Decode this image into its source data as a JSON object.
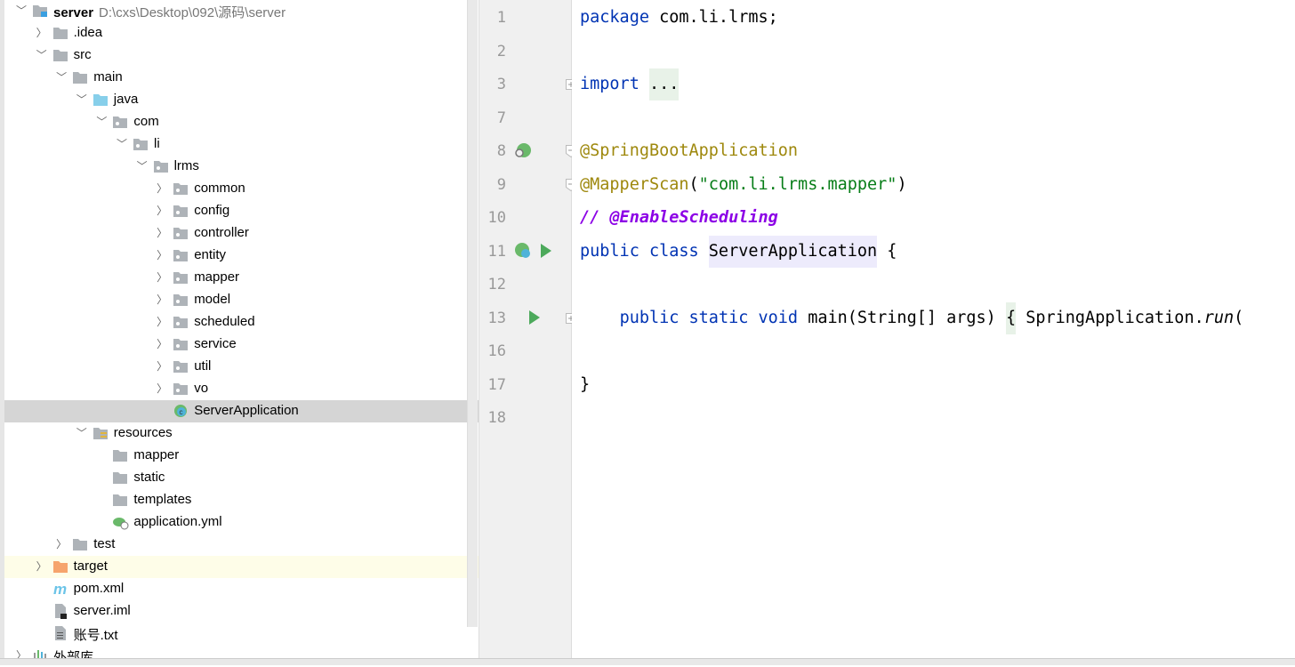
{
  "tree": [
    {
      "label": "server",
      "path": "D:\\cxs\\Desktop\\092\\源码\\server",
      "level": 0,
      "chevron": "down",
      "icon": "module",
      "bold": true
    },
    {
      "label": ".idea",
      "level": 1,
      "chevron": "right",
      "icon": "folder"
    },
    {
      "label": "src",
      "level": 1,
      "chevron": "down",
      "icon": "folder"
    },
    {
      "label": "main",
      "level": 2,
      "chevron": "down",
      "icon": "folder"
    },
    {
      "label": "java",
      "level": 3,
      "chevron": "down",
      "icon": "source-folder"
    },
    {
      "label": "com",
      "level": 4,
      "chevron": "down",
      "icon": "package"
    },
    {
      "label": "li",
      "level": 5,
      "chevron": "down",
      "icon": "package"
    },
    {
      "label": "lrms",
      "level": 6,
      "chevron": "down",
      "icon": "package"
    },
    {
      "label": "common",
      "level": 7,
      "chevron": "right",
      "icon": "package"
    },
    {
      "label": "config",
      "level": 7,
      "chevron": "right",
      "icon": "package"
    },
    {
      "label": "controller",
      "level": 7,
      "chevron": "right",
      "icon": "package"
    },
    {
      "label": "entity",
      "level": 7,
      "chevron": "right",
      "icon": "package"
    },
    {
      "label": "mapper",
      "level": 7,
      "chevron": "right",
      "icon": "package"
    },
    {
      "label": "model",
      "level": 7,
      "chevron": "right",
      "icon": "package"
    },
    {
      "label": "scheduled",
      "level": 7,
      "chevron": "right",
      "icon": "package"
    },
    {
      "label": "service",
      "level": 7,
      "chevron": "right",
      "icon": "package"
    },
    {
      "label": "util",
      "level": 7,
      "chevron": "right",
      "icon": "package"
    },
    {
      "label": "vo",
      "level": 7,
      "chevron": "right",
      "icon": "package"
    },
    {
      "label": "ServerApplication",
      "level": 7,
      "chevron": "none",
      "icon": "spring-class",
      "selected": true
    },
    {
      "label": "resources",
      "level": 3,
      "chevron": "down",
      "icon": "resources-folder"
    },
    {
      "label": "mapper",
      "level": 4,
      "chevron": "none",
      "icon": "folder"
    },
    {
      "label": "static",
      "level": 4,
      "chevron": "none",
      "icon": "folder"
    },
    {
      "label": "templates",
      "level": 4,
      "chevron": "none",
      "icon": "folder"
    },
    {
      "label": "application.yml",
      "level": 4,
      "chevron": "none",
      "icon": "spring-config"
    },
    {
      "label": "test",
      "level": 2,
      "chevron": "right",
      "icon": "folder"
    },
    {
      "label": "target",
      "level": 1,
      "chevron": "right",
      "icon": "excluded-folder",
      "highlight": true
    },
    {
      "label": "pom.xml",
      "level": 1,
      "chevron": "none",
      "icon": "maven"
    },
    {
      "label": "server.iml",
      "level": 1,
      "chevron": "none",
      "icon": "iml-file"
    },
    {
      "label": "账号.txt",
      "level": 1,
      "chevron": "none",
      "icon": "text-file"
    },
    {
      "label": "外部库",
      "level": 0,
      "chevron": "right",
      "icon": "library"
    }
  ],
  "editor": {
    "lines": [
      {
        "num": "1",
        "tokens": [
          [
            "kw",
            "package "
          ],
          [
            "",
            "com.li.lrms;"
          ]
        ]
      },
      {
        "num": "2",
        "tokens": []
      },
      {
        "num": "3",
        "tokens": [
          [
            "kw",
            "import "
          ],
          [
            "fold",
            "..."
          ]
        ],
        "fold": "plus"
      },
      {
        "num": "7",
        "tokens": []
      },
      {
        "num": "8",
        "tokens": [
          [
            "an",
            "@SpringBootApplication"
          ]
        ],
        "fold": "minus",
        "gutter": "spring-bean"
      },
      {
        "num": "9",
        "tokens": [
          [
            "an",
            "@MapperScan"
          ],
          [
            "",
            "("
          ],
          [
            "str",
            "\"com.li.lrms.mapper\""
          ],
          [
            "",
            ")"
          ]
        ],
        "fold": "end"
      },
      {
        "num": "10",
        "tokens": [
          [
            "cm",
            "// @EnableScheduling"
          ]
        ]
      },
      {
        "num": "11",
        "tokens": [
          [
            "kw",
            "public class "
          ],
          [
            "cls",
            "ServerApplication"
          ],
          [
            "",
            " {"
          ]
        ],
        "gutter": "spring-run",
        "current": true
      },
      {
        "num": "12",
        "tokens": []
      },
      {
        "num": "13",
        "tokens": [
          [
            "",
            "    "
          ],
          [
            "kw",
            "public static void "
          ],
          [
            "",
            "main(String[] args) "
          ],
          [
            "fold",
            "{"
          ],
          [
            "",
            " SpringApplication."
          ],
          [
            "it",
            "run"
          ],
          [
            "",
            "("
          ]
        ],
        "fold": "plus",
        "gutter": "run"
      },
      {
        "num": "16",
        "tokens": []
      },
      {
        "num": "17",
        "tokens": [
          [
            "",
            "}"
          ]
        ]
      },
      {
        "num": "18",
        "tokens": []
      }
    ]
  },
  "colors": {
    "keyword": "#0033b3",
    "annotation": "#9e880d",
    "string": "#067d17",
    "comment": "#8c00e6",
    "selection": "#d5d5d5"
  }
}
